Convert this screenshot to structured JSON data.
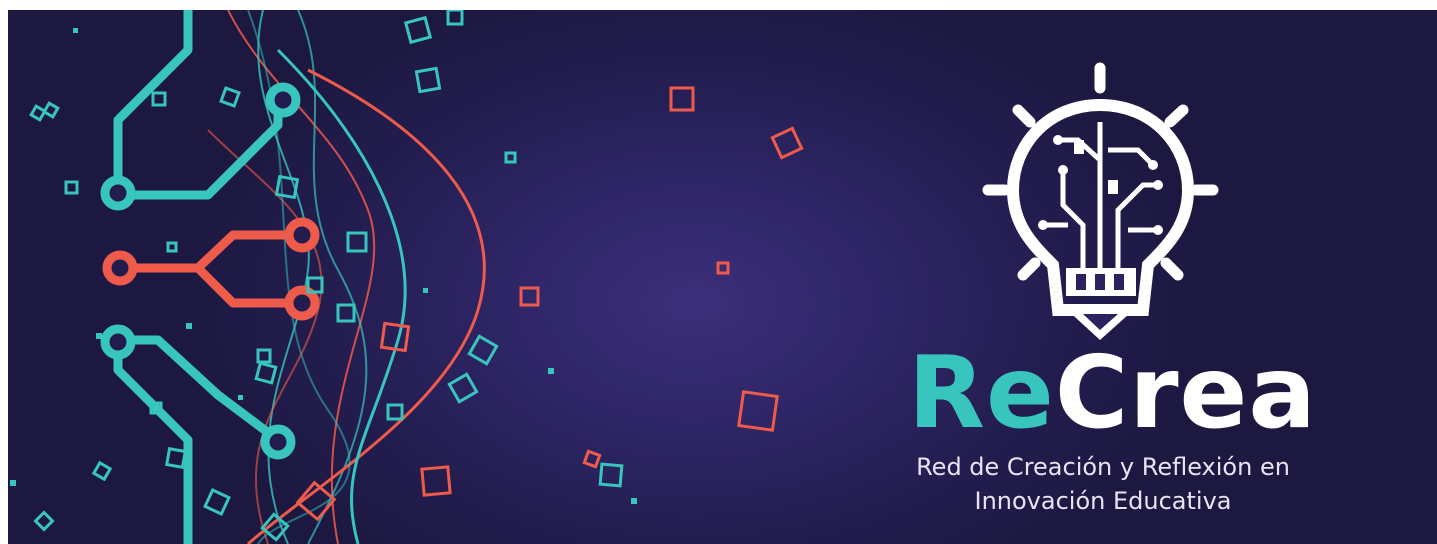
{
  "logo": {
    "name_part1": "Re",
    "name_part2": "Crea",
    "icon": "lightbulb-circuit-icon"
  },
  "subtitle": {
    "line1": "Red de Creación y Reflexión en",
    "line2": "Innovación Educativa"
  },
  "colors": {
    "background": "#2b2260",
    "teal": "#37c5bd",
    "coral": "#ee5b4a",
    "white": "#ffffff"
  }
}
